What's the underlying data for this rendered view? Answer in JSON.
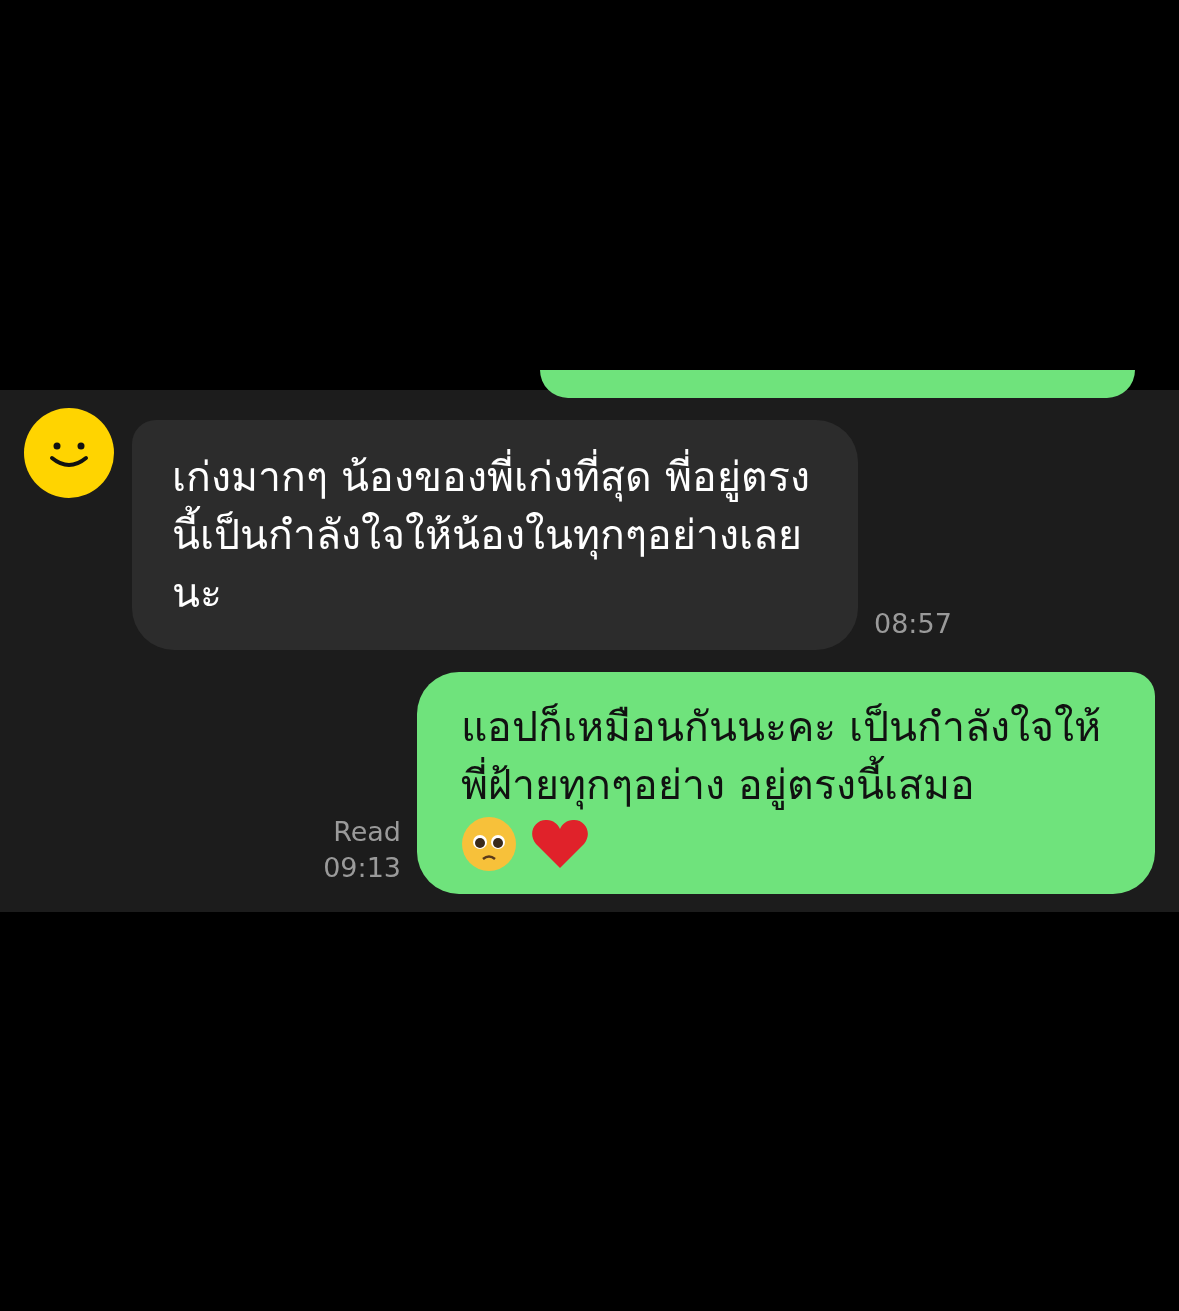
{
  "messages": [
    {
      "kind": "received",
      "text": "เก่งมากๆ น้องของพี่เก่งที่สุด พี่อยู่ตรงนี้เป็นกำลังใจให้น้องในทุกๆอย่างเลยนะ",
      "time": "08:57"
    },
    {
      "kind": "sent",
      "text": "แอปก็เหมือนกันนะคะ เป็นกำลังใจให้พี่ฝ้ายทุกๆอย่าง อยู่ตรงนี้เสมอ",
      "read": "Read",
      "time": "09:13",
      "emoji": [
        {
          "kind": "pleading-face"
        },
        {
          "kind": "heart"
        }
      ]
    }
  ]
}
